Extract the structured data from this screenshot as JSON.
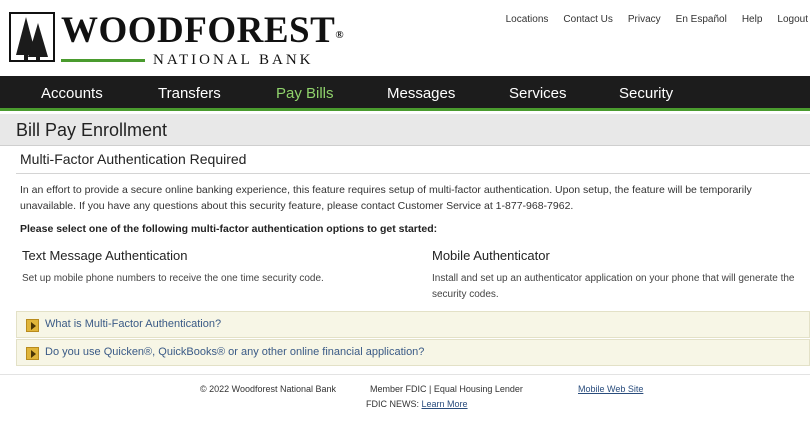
{
  "header": {
    "logo_name": "WOODFOREST",
    "logo_reg": "®",
    "logo_sub": "NATIONAL BANK",
    "top_links": [
      "Locations",
      "Contact Us",
      "Privacy",
      "En Español",
      "Help",
      "Logout"
    ]
  },
  "nav": {
    "items": [
      "Accounts",
      "Transfers",
      "Pay Bills",
      "Messages",
      "Services",
      "Security"
    ],
    "active": "Pay Bills"
  },
  "page": {
    "title": "Bill Pay Enrollment",
    "subtitle": "Multi-Factor Authentication Required",
    "intro": "In an effort to provide a secure online banking experience, this feature requires setup of multi-factor authentication. Upon setup, the feature will be temporarily unavailable. If you have any questions about this security feature, please contact Customer Service at 1-877-968-7962.",
    "instruction": "Please select one of the following multi-factor authentication options to get started:"
  },
  "options": [
    {
      "title": "Text Message Authentication",
      "description": "Set up mobile phone numbers to receive the one time security code."
    },
    {
      "title": "Mobile Authenticator",
      "description": "Install and set up an authenticator application on your phone that will generate the security codes."
    }
  ],
  "accordions": [
    {
      "label": "What is Multi-Factor Authentication?"
    },
    {
      "label": "Do you use Quicken®, QuickBooks® or any other online financial application?"
    }
  ],
  "footer": {
    "copyright": "© 2022 Woodforest National Bank",
    "member": "Member FDIC | Equal Housing Lender",
    "mobile_link": "Mobile Web Site",
    "news_prefix": "FDIC NEWS:",
    "news_link": "Learn More"
  },
  "colors": {
    "nav_bg": "#1c1c1c",
    "brand_green": "#4a9b2e",
    "active_nav": "#8fd26b",
    "accordion_bg": "#f7f6e6",
    "link": "#3a5a86"
  }
}
